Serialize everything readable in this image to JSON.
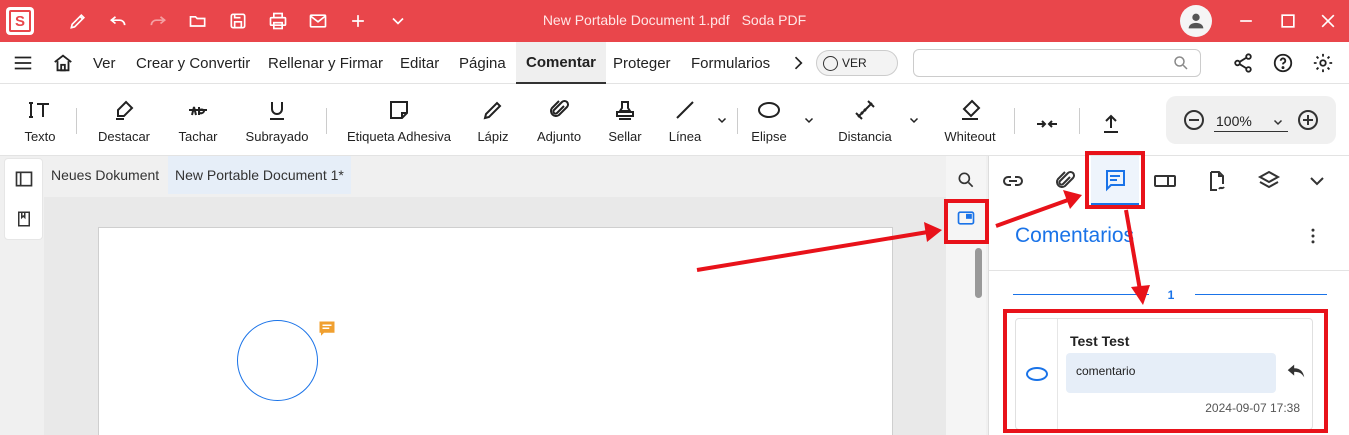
{
  "window": {
    "document_title": "New Portable Document 1.pdf",
    "app_name": "Soda PDF",
    "logo_letter": "S"
  },
  "menu": {
    "items": [
      "Ver",
      "Crear y Convertir",
      "Rellenar y Firmar",
      "Editar",
      "Página",
      "Comentar",
      "Proteger",
      "Formularios"
    ],
    "active": "Comentar",
    "ver_toggle_label": "VER",
    "search_placeholder": ""
  },
  "toolbar": {
    "tools": [
      "Texto",
      "Destacar",
      "Tachar",
      "Subrayado",
      "Etiqueta Adhesiva",
      "Lápiz",
      "Adjunto",
      "Sellar",
      "Línea",
      "Elipse",
      "Distancia",
      "Whiteout"
    ],
    "zoom": "100%"
  },
  "doc_tabs": [
    "Neues Dokument",
    "New Portable Document 1*"
  ],
  "panel": {
    "title": "Comentarios",
    "page_number": "1",
    "comment": {
      "author": "Test Test",
      "text": "comentario",
      "date": "2024-09-07 17:38"
    }
  },
  "colors": {
    "titlebar": "#e9464b",
    "accent": "#1a73e8",
    "highlight": "#e8121a",
    "note": "#f0a030"
  }
}
